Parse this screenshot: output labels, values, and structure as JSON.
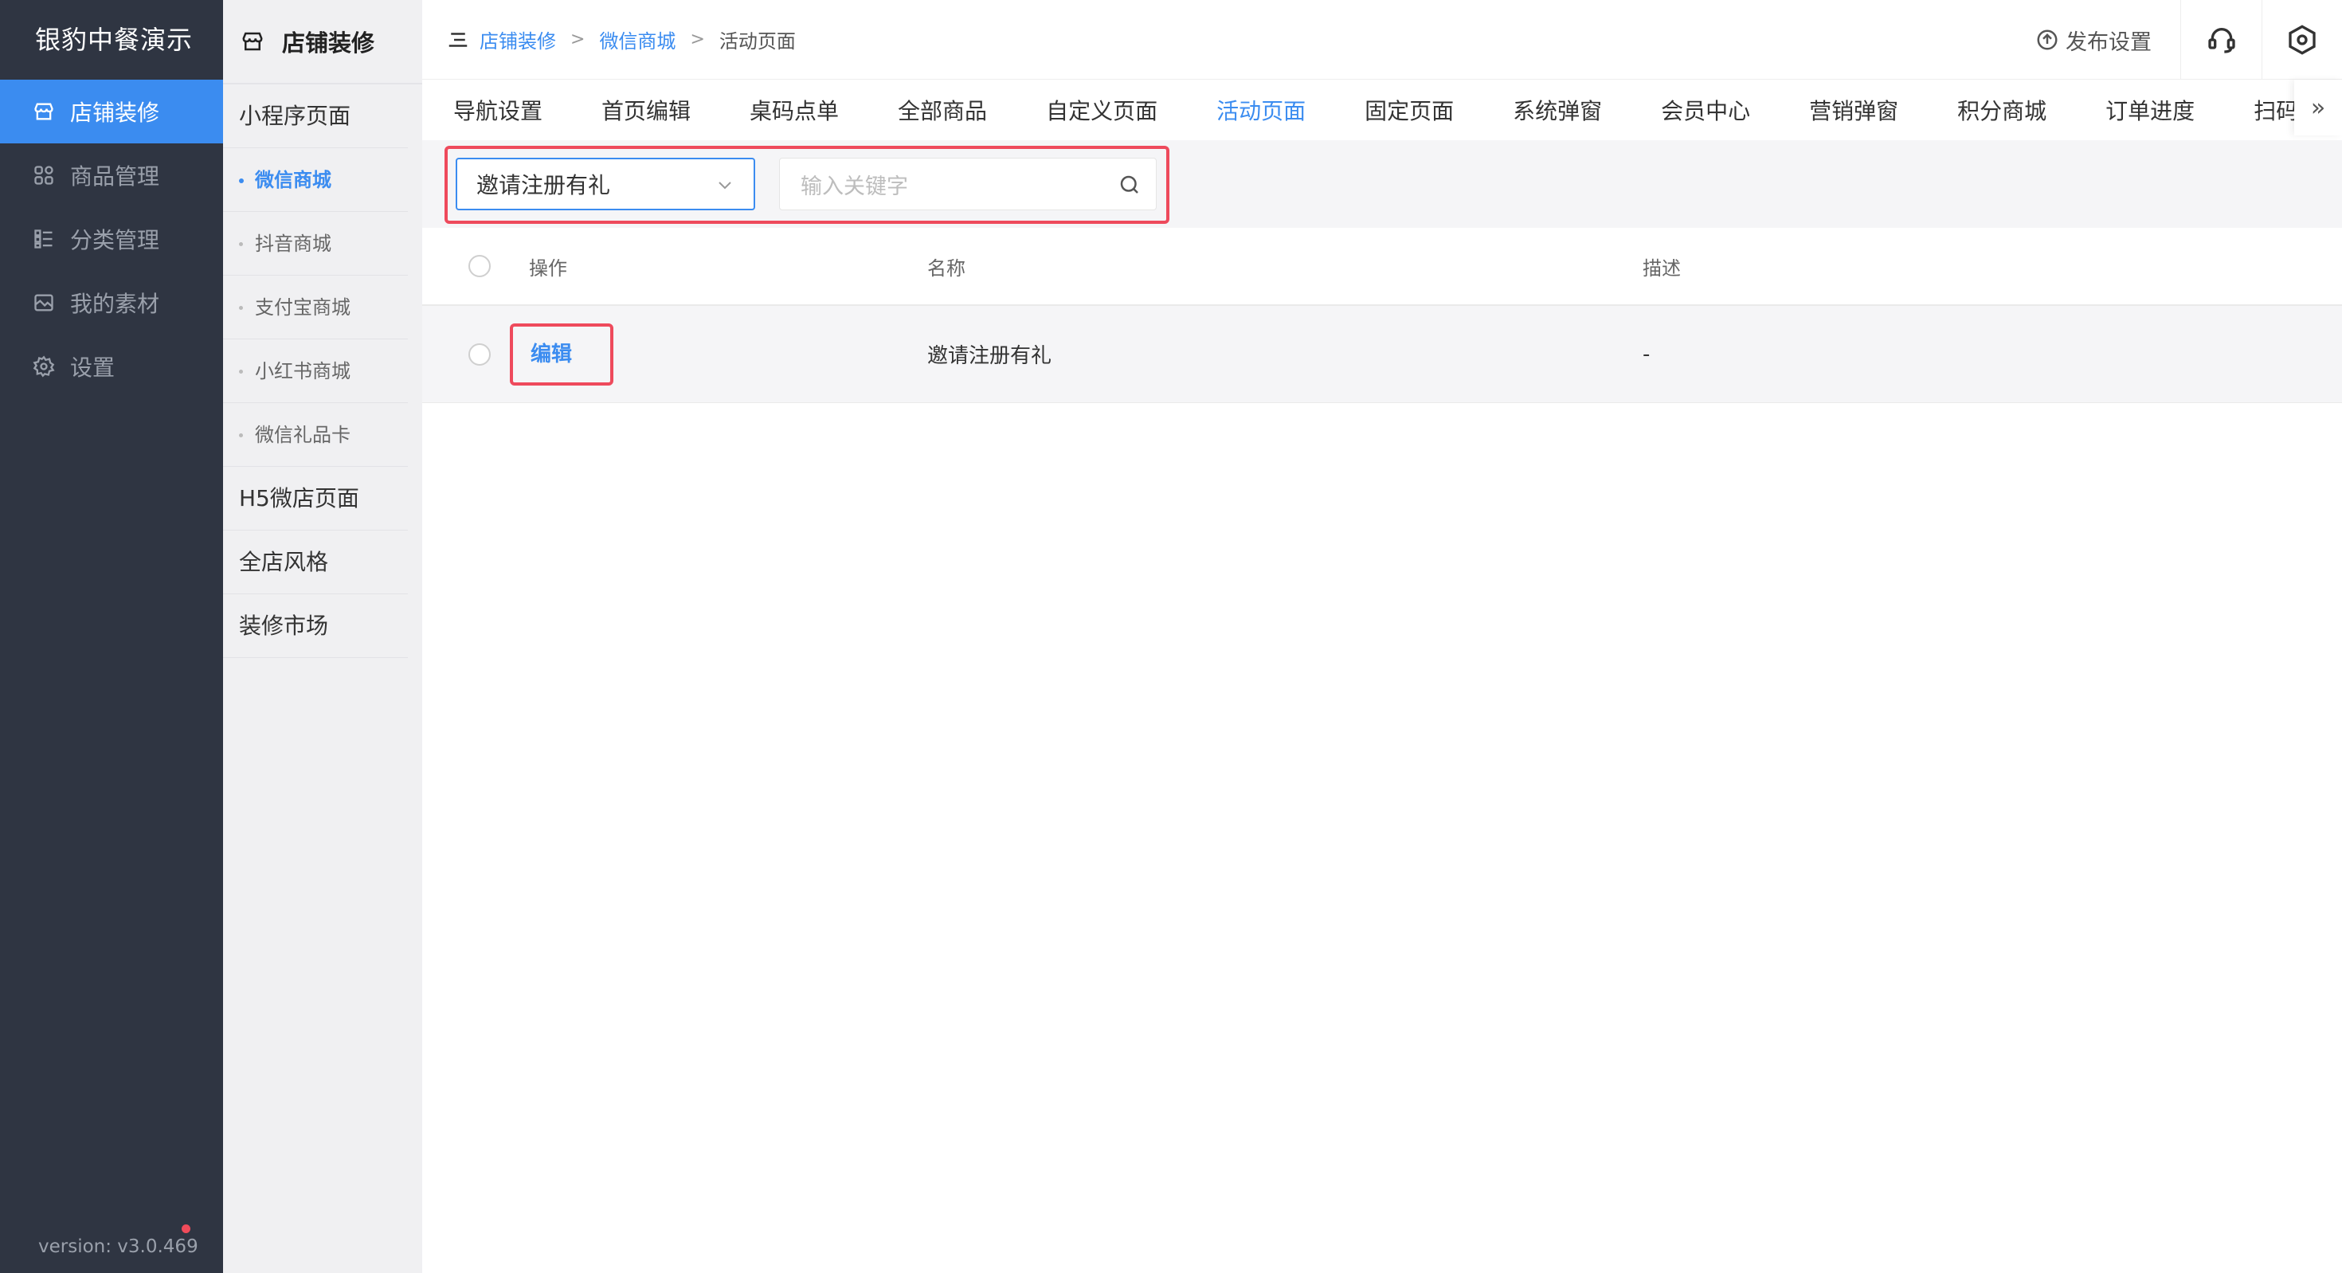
{
  "app": {
    "brand": "银豹中餐演示",
    "version": "version: v3.0.469"
  },
  "sidebar": {
    "items": [
      {
        "label": "店铺装修",
        "icon": "store-icon",
        "active": true
      },
      {
        "label": "商品管理",
        "icon": "grid-icon",
        "active": false
      },
      {
        "label": "分类管理",
        "icon": "list-icon",
        "active": false
      },
      {
        "label": "我的素材",
        "icon": "image-icon",
        "active": false
      },
      {
        "label": "设置",
        "icon": "gear-icon",
        "active": false
      }
    ]
  },
  "subnav": {
    "title": "店铺装修",
    "group1": "小程序页面",
    "items": [
      {
        "label": "微信商城",
        "active": true
      },
      {
        "label": "抖音商城",
        "active": false
      },
      {
        "label": "支付宝商城",
        "active": false
      },
      {
        "label": "小红书商城",
        "active": false
      },
      {
        "label": "微信礼品卡",
        "active": false
      }
    ],
    "group2": "H5微店页面",
    "group3": "全店风格",
    "group4": "装修市场"
  },
  "header": {
    "breadcrumb": [
      "店铺装修",
      "微信商城",
      "活动页面"
    ],
    "separator": ">",
    "publish_label": "发布设置"
  },
  "tabs": [
    "导航设置",
    "首页编辑",
    "桌码点单",
    "全部商品",
    "自定义页面",
    "活动页面",
    "固定页面",
    "系统弹窗",
    "会员中心",
    "营销弹窗",
    "积分商城",
    "订单进度",
    "扫码"
  ],
  "active_tab": "活动页面",
  "filter": {
    "selected": "邀请注册有礼",
    "search_placeholder": "输入关键字"
  },
  "table": {
    "headers": {
      "op": "操作",
      "name": "名称",
      "desc": "描述"
    },
    "rows": [
      {
        "op": "编辑",
        "name": "邀请注册有礼",
        "desc": "-"
      }
    ]
  },
  "colors": {
    "accent": "#3b8cf0",
    "sidebar_bg": "#2f3542",
    "highlight": "#ee4a5c"
  }
}
